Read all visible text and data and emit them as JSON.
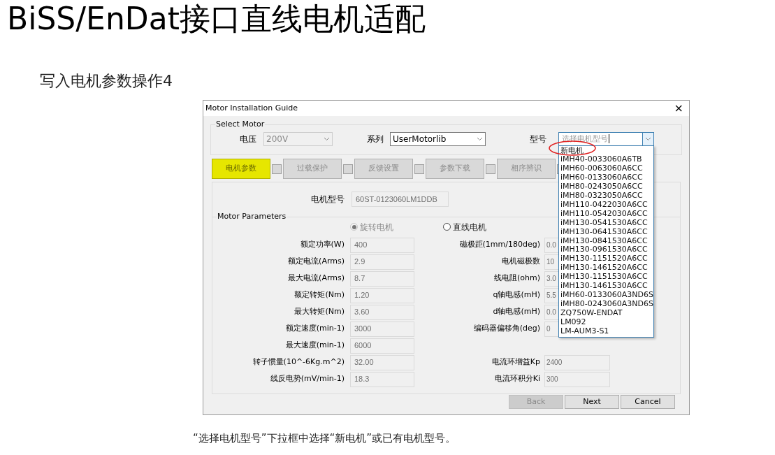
{
  "slide_title": "BiSS/EnDat接口直线电机适配",
  "subtitle": "写入电机参数操作4",
  "window": {
    "title": "Motor Installation Guide",
    "close": "×"
  },
  "select_motor": {
    "title": "Select Motor",
    "voltage": {
      "label": "电压",
      "value": "200V",
      "disabled": true
    },
    "series": {
      "label": "系列",
      "value": "UserMotorlib",
      "disabled": false
    },
    "model": {
      "label": "型号",
      "placeholder": "选择电机型号",
      "expanded": true,
      "options": [
        "新电机",
        "iMH40-0033060A6TB",
        "iMH60-0063060A6CC",
        "iMH60-0133060A6CC",
        "iMH80-0243050A6CC",
        "iMH80-0323050A6CC",
        "iMH110-0422030A6CC",
        "iMH110-0542030A6CC",
        "iMH130-0541530A6CC",
        "iMH130-0641530A6CC",
        "iMH130-0841530A6CC",
        "iMH130-0961530A6CC",
        "iMH130-1151520A6CC",
        "iMH130-1461520A6CC",
        "iMH130-1151530A6CC",
        "iMH130-1461530A6CC",
        "iMH60-0133060A3ND6S",
        "iMH80-0243060A3ND6S",
        "ZQ750W-ENDAT",
        "LM092",
        "LM-AUM3-S1"
      ]
    }
  },
  "steps": [
    {
      "label": "电机参数",
      "selected": true
    },
    {
      "label": "过载保护",
      "selected": false
    },
    {
      "label": "反馈设置",
      "selected": false
    },
    {
      "label": "参数下载",
      "selected": false
    },
    {
      "label": "相序辨识",
      "selected": false
    }
  ],
  "motor_model": {
    "label": "电机型号",
    "value": "60ST-0123060LM1DDB"
  },
  "motor_parameters": {
    "title": "Motor Parameters",
    "motor_types": [
      {
        "label": "旋转电机",
        "selected": true,
        "disabled": true
      },
      {
        "label": "直线电机",
        "selected": false,
        "disabled": false
      }
    ],
    "rows": [
      {
        "left": {
          "label": "额定功率(W)",
          "value": "400"
        },
        "right": {
          "label": "磁极距(1mm/180deg)",
          "value": "0.0"
        }
      },
      {
        "left": {
          "label": "额定电流(Arms)",
          "value": "2.9"
        },
        "right": {
          "label": "电机磁极数",
          "value": "10"
        }
      },
      {
        "left": {
          "label": "最大电流(Arms)",
          "value": "8.7"
        },
        "right": {
          "label": "线电阻(ohm)",
          "value": "3.0"
        }
      },
      {
        "left": {
          "label": "额定转矩(Nm)",
          "value": "1.20"
        },
        "right": {
          "label": "q轴电感(mH)",
          "value": "5.5"
        }
      },
      {
        "left": {
          "label": "最大转矩(Nm)",
          "value": "3.60"
        },
        "right": {
          "label": "d轴电感(mH)",
          "value": "0.0"
        }
      },
      {
        "left": {
          "label": "额定速度(min-1)",
          "value": "3000"
        },
        "right": {
          "label": "编码器偏移角(deg)",
          "value": "0"
        }
      },
      {
        "left": {
          "label": "最大速度(min-1)",
          "value": "6000"
        }
      },
      {
        "left": {
          "label": "转子惯量(10^-6Kg.m^2)",
          "value": "32.00"
        },
        "right": {
          "label": "电流环增益Kp",
          "value": "2400"
        }
      },
      {
        "left": {
          "label": "线反电势(mV/min-1)",
          "value": "18.3"
        },
        "right": {
          "label": "电流环积分Ki",
          "value": "300"
        }
      }
    ]
  },
  "buttons": [
    {
      "label": "Back",
      "disabled": true
    },
    {
      "label": "Next",
      "disabled": false
    },
    {
      "label": "Cancel",
      "disabled": false
    }
  ],
  "caption": "“选择电机型号”下拉框中选择“新电机”或已有电机型号。"
}
